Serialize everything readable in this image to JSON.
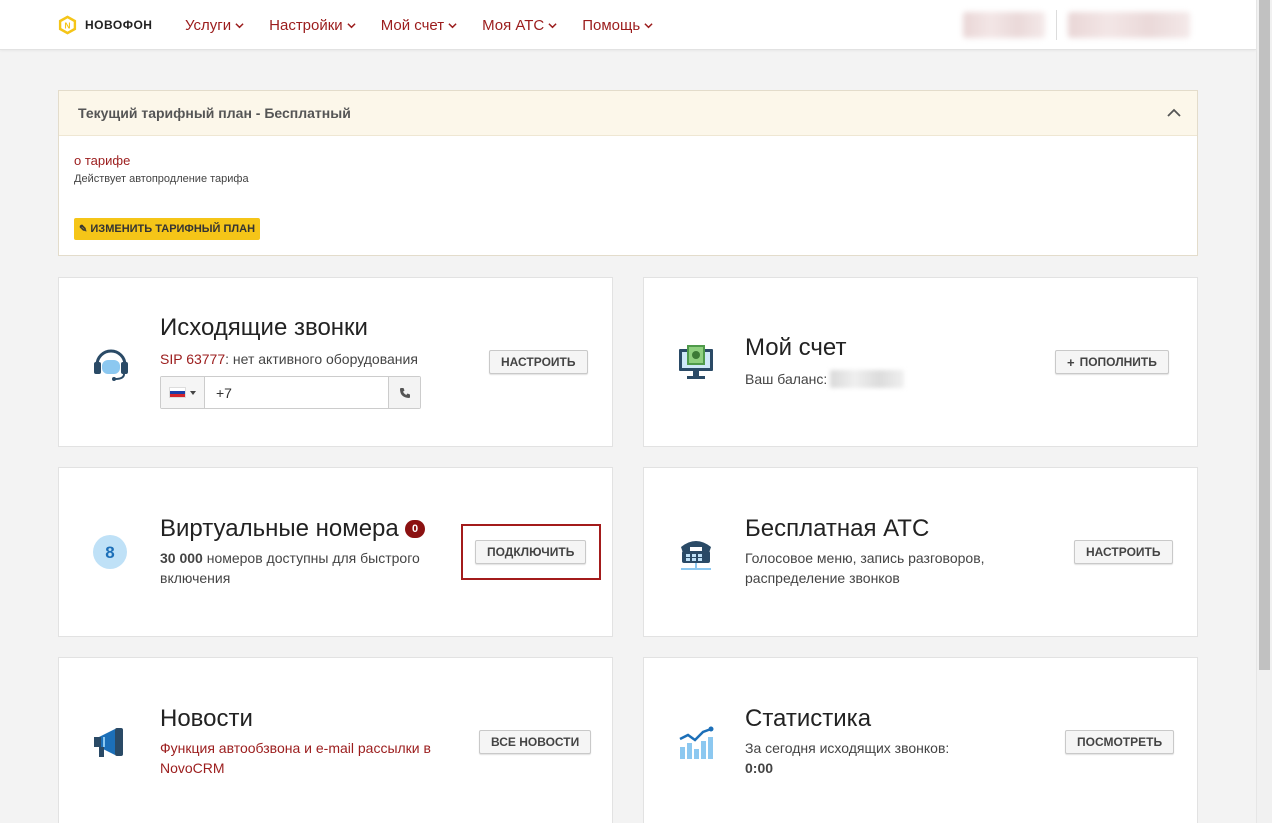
{
  "app": {
    "logo_text": "НОВОФОН",
    "accent": "#9b1c1c",
    "brand_yellow": "#f5c518"
  },
  "nav": {
    "items": [
      {
        "label": "Услуги"
      },
      {
        "label": "Настройки"
      },
      {
        "label": "Мой счет"
      },
      {
        "label": "Моя АТС"
      },
      {
        "label": "Помощь"
      }
    ]
  },
  "tariff": {
    "title": "Текущий тарифный план - Бесплатный",
    "about_link": "о тарифе",
    "note": "Действует автопродление тарифа",
    "change_button": "ИЗМЕНИТЬ ТАРИФНЫЙ ПЛАН"
  },
  "outgoing": {
    "title": "Исходящие звонки",
    "sip_label": "SIP 63777",
    "status": ": нет активного оборудования",
    "phone_value": "+7",
    "button": "НАСТРОИТЬ",
    "icon": "headset-icon"
  },
  "account": {
    "title": "Мой счет",
    "balance_label": "Ваш баланс:",
    "button": "ПОПОЛНИТЬ",
    "button_icon": "+",
    "icon": "monitor-money-icon"
  },
  "virtual_numbers": {
    "title": "Виртуальные номера",
    "badge": "0",
    "count": "30 000",
    "desc_line1": " номеров доступны для быстрого",
    "desc_line2": "включения",
    "button": "ПОДКЛЮЧИТЬ",
    "icon_text": "8"
  },
  "free_pbx": {
    "title": "Бесплатная АТС",
    "desc_line1": "Голосовое меню, запись разговоров,",
    "desc_line2": "распределение звонков",
    "button": "НАСТРОИТЬ",
    "icon": "pbx-phone-icon"
  },
  "news": {
    "title": "Новости",
    "desc_line1": "Функция автообзвона и e-mail рассылки в",
    "desc_line2": "NovoCRM",
    "button": "ВСЕ НОВОСТИ",
    "icon": "megaphone-icon"
  },
  "stats": {
    "title": "Статистика",
    "desc": "За сегодня исходящих звонков:",
    "value": "0:00",
    "button": "ПОСМОТРЕТЬ",
    "icon": "bar-chart-icon"
  }
}
